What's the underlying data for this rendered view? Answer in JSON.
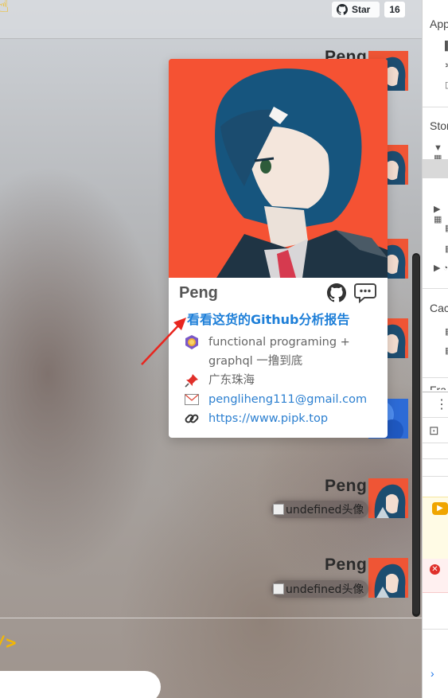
{
  "topbar": {
    "hand_icon": "pointing-hand-icon",
    "star_label": "Star",
    "star_count": "16"
  },
  "messages": [
    {
      "name": "Peng"
    },
    {
      "name": "Peng",
      "broken_image_alt": "undefined头像"
    },
    {
      "name": "Peng",
      "broken_image_alt": "undefined头像"
    }
  ],
  "profile_card": {
    "name": "Peng",
    "report_link": "看看这货的Github分析报告",
    "bio": "functional programing + graphql 一撸到底",
    "location": "广东珠海",
    "email": "pengliheng111@gmail.com",
    "website": "https://www.pipk.top",
    "icons": [
      "github-icon",
      "chat-icon",
      "lion-icon",
      "pin-icon",
      "email-icon",
      "link-icon"
    ]
  },
  "footer": {
    "code_mark": "/>"
  },
  "devtools": {
    "section_app": "App",
    "section_storage": "Stor",
    "section_cache": "Cac",
    "section_frames": "Fra"
  },
  "colors": {
    "accent_link": "#1e7fd8",
    "avatar_bg": "#ef5535",
    "star_bg": "#fafbfc",
    "annotation_arrow": "#e8261f"
  }
}
